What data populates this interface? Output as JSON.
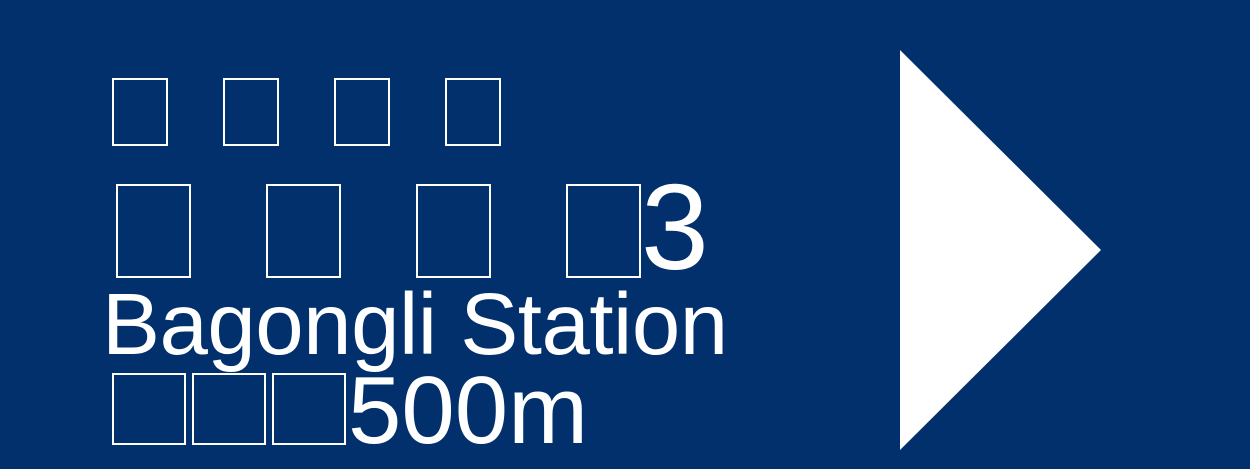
{
  "sign": {
    "background_color": "#02306c",
    "text_color": "#ffffff",
    "top_line": {
      "glyph_count": 4,
      "glyphs": [
        "□",
        "□",
        "□",
        "□"
      ]
    },
    "chinese_line": {
      "glyph_count": 4,
      "glyphs": [
        "□",
        "□",
        "□",
        "□"
      ],
      "suffix": "3"
    },
    "english_name": "Bagongli Station",
    "distance_line": {
      "glyph_count": 3,
      "glyphs": [
        "□",
        "□",
        "□"
      ],
      "value": "500m"
    },
    "arrow": {
      "icon": "right-arrow-icon",
      "direction": "right",
      "color": "#ffffff"
    }
  }
}
